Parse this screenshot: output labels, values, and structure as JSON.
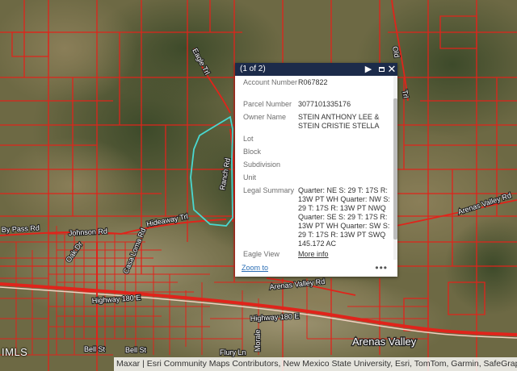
{
  "map": {
    "roads": {
      "eagle_trl_top": "Eagle Trl",
      "old": "Old",
      "trl_right": "Trl",
      "ranch_rd": "Ranch Rd",
      "hideaway_trl": "Hideaway Trl",
      "by_pass_rd": "By Pass Rd",
      "johnson_rd": "Johnson Rd",
      "oak_dr": "Oak Dr",
      "casa_loma_rd": "Casa Loma Rd",
      "arenas_valley_rd_right": "Arenas Valley Rd",
      "arenas_valley_rd_mid": "Arenas Valley Rd",
      "highway_180_e_left": "Highway 180 E",
      "highway_180_e_right": "Highway 180 E",
      "bell_st_left": "Bell St",
      "bell_st_mid": "Bell St",
      "flury_ln": "Flury Ln",
      "morale": "Morale"
    },
    "place_label": "Arenas Valley",
    "watermark": "IMLS",
    "attribution": "Maxar | Esri Community Maps Contributors, New Mexico State University, Esri, TomTom, Garmin, SafeGraph, GeoTechnologies"
  },
  "popup": {
    "title": "(1 of 2)",
    "next_icon": "play-icon",
    "maximize_icon": "maximize-icon",
    "close_icon": "close-icon",
    "fields": [
      {
        "label": "Account Number",
        "value": "R067822"
      },
      {
        "label": "Parcel Number",
        "value": "3077101335176"
      },
      {
        "label": "Owner Name",
        "value": "STEIN ANTHONY LEE & STEIN CRISTIE STELLA"
      },
      {
        "label": "Lot",
        "value": ""
      },
      {
        "label": "Block",
        "value": ""
      },
      {
        "label": "Subdivision",
        "value": ""
      },
      {
        "label": "Unit",
        "value": ""
      },
      {
        "label": "Legal Summary",
        "value": "Quarter: NE S: 29 T: 17S R: 13W PT WH Quarter: NW S: 29 T: 17S R: 13W PT NWQ Quarter: SE S: 29 T: 17S R: 13W PT WH Quarter: SW S: 29 T: 17S R: 13W PT SWQ 145.172 AC"
      },
      {
        "label": "Eagle View",
        "value": "More info"
      }
    ],
    "zoom_label": "Zoom to",
    "more_label": "•••"
  },
  "colors": {
    "parcel_line": "#e0241b",
    "highlight": "#49d8d0",
    "popup_header": "#1c2b4a",
    "link": "#2a6db4"
  }
}
